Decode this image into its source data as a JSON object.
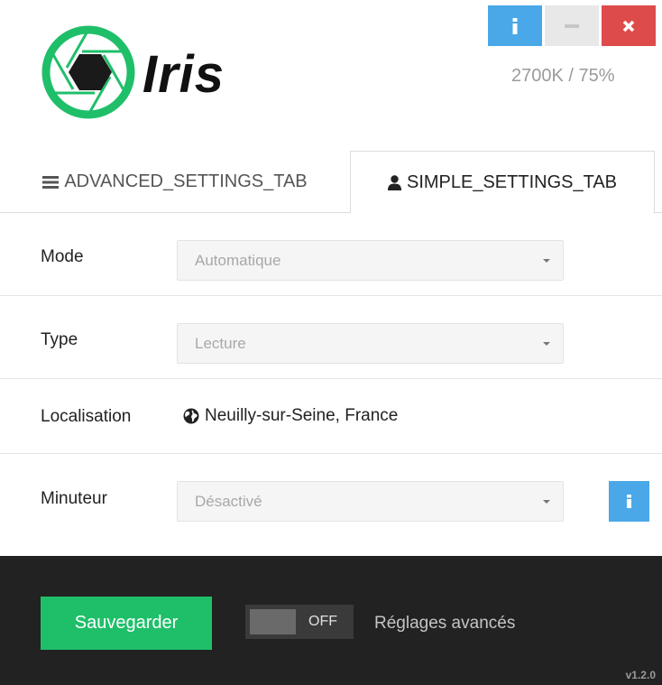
{
  "header": {
    "app_name": "Iris",
    "status_readout": "2700K / 75%",
    "window_buttons": [
      "info",
      "minimize",
      "close"
    ]
  },
  "tabs": [
    {
      "label": "ADVANCED_SETTINGS_TAB",
      "icon": "bars-icon",
      "active": false
    },
    {
      "label": "SIMPLE_SETTINGS_TAB",
      "icon": "user-icon",
      "active": true
    }
  ],
  "form": {
    "mode": {
      "label": "Mode",
      "value": "Automatique"
    },
    "type": {
      "label": "Type",
      "value": "Lecture"
    },
    "location": {
      "label": "Localisation",
      "value": "Neuilly-sur-Seine, France",
      "icon": "globe-icon"
    },
    "timer": {
      "label": "Minuteur",
      "value": "Désactivé"
    }
  },
  "footer": {
    "save_label": "Sauvegarder",
    "toggle_state": "OFF",
    "advanced_label": "Réglages avancés",
    "version": "v1.2.0"
  },
  "colors": {
    "accent_green": "#1fbf6a",
    "info_blue": "#4aa8e8",
    "close_red": "#dd4b4b",
    "footer_bg": "#222222"
  }
}
